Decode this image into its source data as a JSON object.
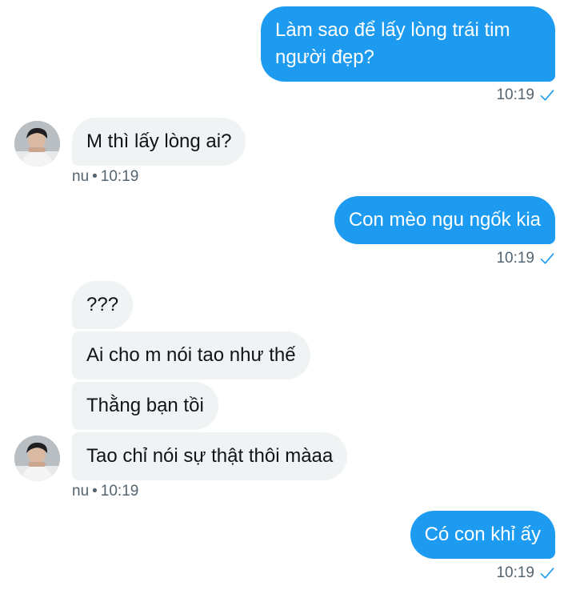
{
  "colors": {
    "outgoing_bubble": "#1d9bf0",
    "incoming_bubble": "#eff3f4",
    "meta_text": "#536471",
    "check": "#1d9bf0"
  },
  "messages": {
    "m1": {
      "text": "Làm sao để lấy lòng trái tim người đẹp?",
      "time": "10:19"
    },
    "m2": {
      "text": "M thì lấy lòng ai?",
      "sender": "nu",
      "time": "10:19"
    },
    "m3": {
      "text": "Con mèo ngu ngốk kia",
      "time": "10:19"
    },
    "m4": {
      "text": "???"
    },
    "m5": {
      "text": "Ai cho m nói tao như thế"
    },
    "m6": {
      "text": "Thằng bạn tồi"
    },
    "m7": {
      "text": "Tao chỉ nói sự thật thôi màaa",
      "sender": "nu",
      "time": "10:19"
    },
    "m8": {
      "text": "Có con khỉ ấy",
      "time": "10:19"
    }
  },
  "icons": {
    "read": "check-icon",
    "avatar": "avatar-image"
  },
  "separator": "•"
}
